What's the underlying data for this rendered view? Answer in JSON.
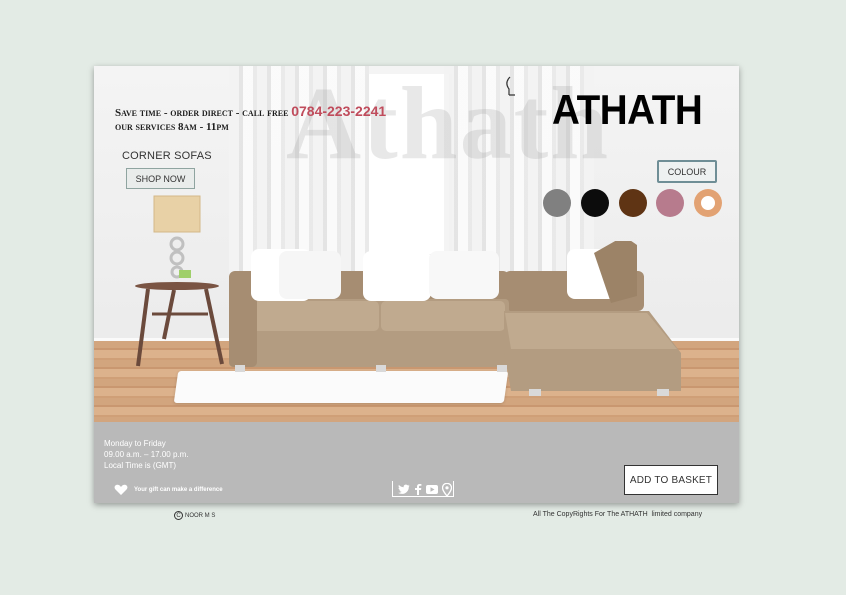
{
  "hero": {
    "watermark": "Athath",
    "promo_line1": "Save time - order direct - call free ",
    "phone": "0784-223-2241",
    "promo_line2": "our services 8am - 11pm",
    "brand": "ATHATH",
    "category_label": "CORNER SOFAS",
    "shop_now": "SHOP NOW",
    "colour_label": "COLOUR",
    "swatches": [
      {
        "name": "grey",
        "color": "#808080"
      },
      {
        "name": "black",
        "color": "#0c0c0c"
      },
      {
        "name": "brown",
        "color": "#5f3414"
      },
      {
        "name": "rose",
        "color": "#b77b8d"
      },
      {
        "name": "peach",
        "color": "#e2a273"
      }
    ]
  },
  "footer": {
    "hours_days": "Monday to Friday",
    "hours_time": "09.00 a.m. – 17.00 p.m.",
    "local_time": "Local Time is (GMT)",
    "gift_text": "Your gift can make a difference",
    "social_icons": [
      "twitter-icon",
      "facebook-icon",
      "youtube-icon",
      "location-pin-icon"
    ],
    "add_to_basket": "ADD TO BASKET"
  },
  "page_footer": {
    "credit": "NOOR M S",
    "copyright": "All The CopyRights For The ATHATH  limited company"
  }
}
